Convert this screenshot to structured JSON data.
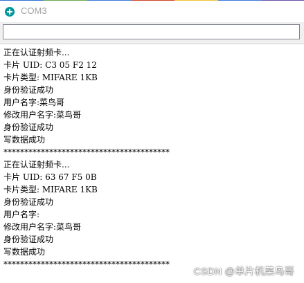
{
  "window": {
    "title": "COM3",
    "app_icon": "arduino-logo-icon",
    "accent_color": "#00979c"
  },
  "send_bar": {
    "input_value": ""
  },
  "monitor": {
    "lines": [
      "正在认证射频卡...",
      "卡片 UID: C3 05 F2 12",
      "卡片类型: MIFARE 1KB",
      "身份验证成功",
      "用户名字:菜鸟哥",
      "修改用户名字:菜鸟哥",
      "身份验证成功",
      "写数据成功",
      "****************************************",
      "正在认证射频卡...",
      "卡片 UID: 63 67 F5 0B",
      "卡片类型: MIFARE 1KB",
      "身份验证成功",
      "用户名字:",
      "修改用户名字:菜鸟哥",
      "身份验证成功",
      "写数据成功",
      "****************************************"
    ]
  },
  "watermark": {
    "text": "CSDN @单片机菜鸟哥"
  },
  "colors": {
    "title_stripe": [
      "#2f6fd0",
      "#6aa84f",
      "#3c78d8",
      "#cc4125",
      "#f1c232",
      "#3c78d8",
      "#674ea7"
    ]
  }
}
